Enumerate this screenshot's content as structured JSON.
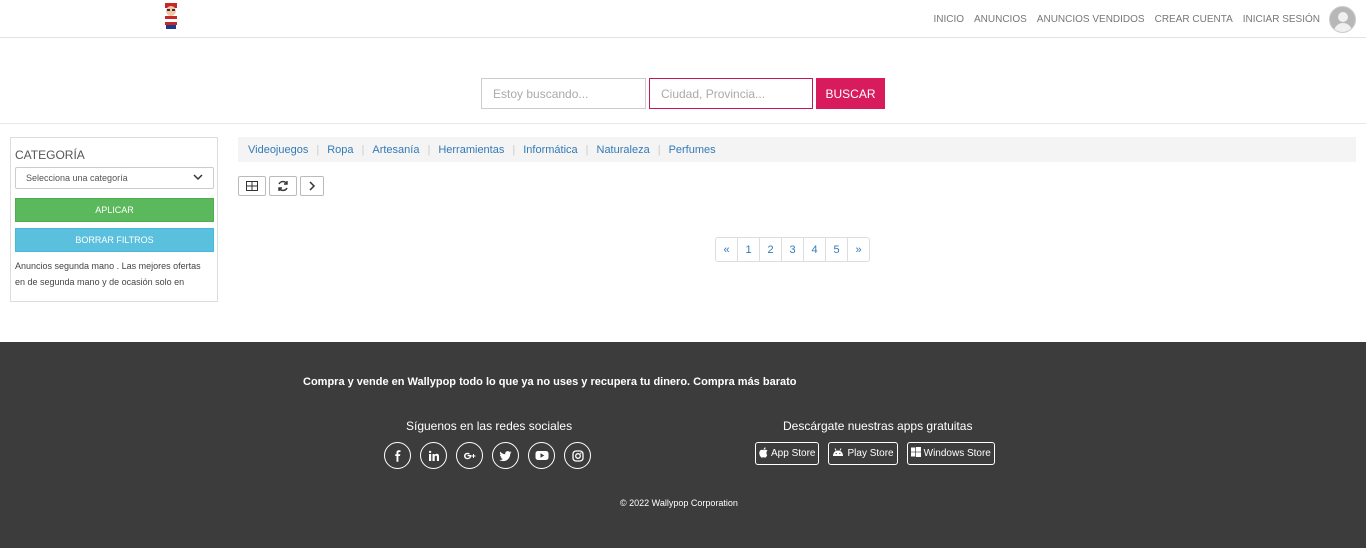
{
  "nav": {
    "items": [
      "INICIO",
      "ANUNCIOS",
      "ANUNCIOS VENDIDOS",
      "CREAR CUENTA",
      "INICIAR SESIÓN"
    ]
  },
  "search": {
    "query_placeholder": "Estoy buscando...",
    "location_placeholder": "Ciudad, Provincia...",
    "button_label": "BUSCAR",
    "accent_color": "#d81b5c"
  },
  "sidebar": {
    "title": "CATEGORÍA",
    "select_value": "Selecciona una categoría",
    "apply_label": "APLICAR",
    "clear_label": "BORRAR FILTROS",
    "description": "Anuncios segunda mano . Las mejores ofertas en de segunda mano y de ocasión solo en"
  },
  "categories": [
    "Videojuegos",
    "Ropa",
    "Artesanía",
    "Herramientas",
    "Informática",
    "Naturaleza",
    "Perfumes"
  ],
  "toolbar": {
    "icons": [
      "grid-icon",
      "refresh-icon",
      "chevron-right-icon"
    ]
  },
  "pagination": {
    "prev": "«",
    "pages": [
      "1",
      "2",
      "3",
      "4",
      "5"
    ],
    "next": "»"
  },
  "footer": {
    "tagline": "Compra y vende en Wallypop todo lo que ya no uses y recupera tu dinero. Compra más barato",
    "social_title": "Síguenos en las redes sociales",
    "apps_title": "Descárgate nuestras apps gratuitas",
    "socials": [
      "facebook-icon",
      "linkedin-icon",
      "google-plus-icon",
      "twitter-icon",
      "youtube-icon",
      "instagram-icon"
    ],
    "apps": [
      "App Store",
      "Play Store",
      "Windows Store"
    ],
    "copyright": "© 2022 Wallypop Corporation",
    "background": "#3c3c3c"
  }
}
